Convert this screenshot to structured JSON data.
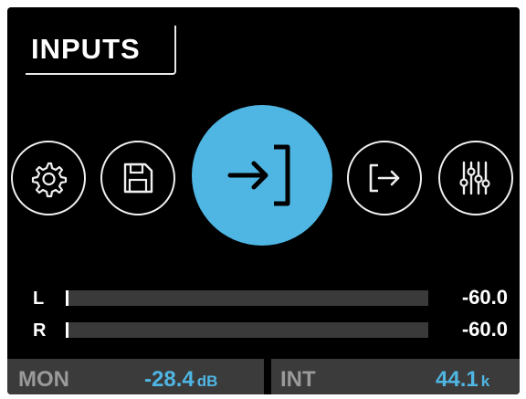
{
  "header": {
    "title": "INPUTS"
  },
  "nav": {
    "items": [
      {
        "name": "settings",
        "icon": "gear-icon",
        "active": false
      },
      {
        "name": "save",
        "icon": "floppy-disk-icon",
        "active": false
      },
      {
        "name": "inputs",
        "icon": "input-arrow-icon",
        "active": true
      },
      {
        "name": "outputs",
        "icon": "output-arrow-icon",
        "active": false
      },
      {
        "name": "mixer",
        "icon": "sliders-icon",
        "active": false
      }
    ]
  },
  "meters": [
    {
      "channel": "L",
      "level_db": -60.0,
      "value_text": "-60.0"
    },
    {
      "channel": "R",
      "level_db": -60.0,
      "value_text": "-60.0"
    }
  ],
  "status": {
    "monitor": {
      "label": "MON",
      "value": "-28.4",
      "unit": "dB"
    },
    "clock": {
      "label": "INT",
      "value": "44.1",
      "unit": "k"
    }
  },
  "colors": {
    "accent": "#4fb6e3",
    "background": "#000000",
    "panel": "#3b3b3b",
    "meter_track": "#3a3a3a"
  }
}
